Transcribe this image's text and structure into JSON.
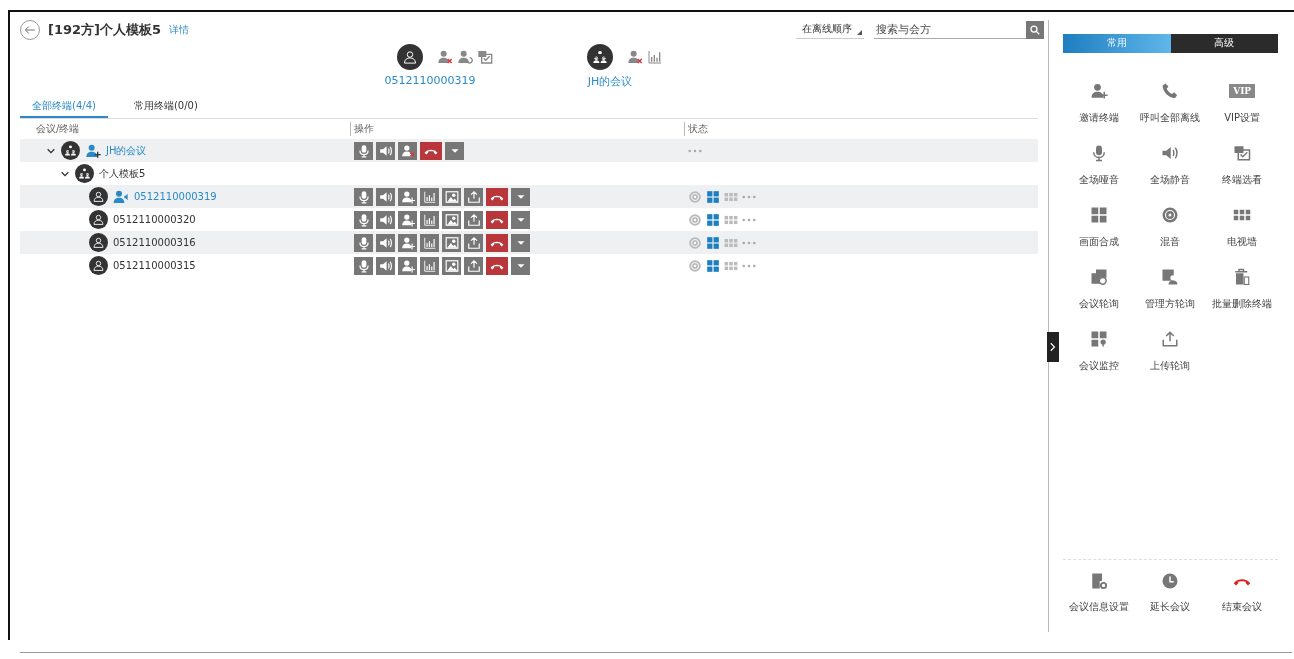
{
  "header": {
    "title": "[192方]个人模板5",
    "details_link": "详情"
  },
  "sort": {
    "value": "在离线顺序"
  },
  "search": {
    "placeholder": "搜索与会方"
  },
  "speakers": [
    {
      "name": "0512110000319",
      "kind": "terminal"
    },
    {
      "name": "JH的会议",
      "kind": "conference"
    }
  ],
  "tabs": [
    {
      "label": "全部终端(4/4)",
      "selected": true
    },
    {
      "label": "常用终端(0/0)",
      "selected": false
    }
  ],
  "table": {
    "columns": [
      "会议/终端",
      "操作",
      "状态"
    ],
    "rows": [
      {
        "name": "JH的会议",
        "kind": "conference",
        "active": true,
        "expanded": true,
        "children": [
          {
            "name": "个人模板5",
            "kind": "group",
            "expanded": true,
            "children": [
              {
                "name": "0512110000319",
                "kind": "terminal",
                "active": true
              },
              {
                "name": "0512110000320",
                "kind": "terminal",
                "active": false
              },
              {
                "name": "0512110000316",
                "kind": "terminal",
                "active": false
              },
              {
                "name": "0512110000315",
                "kind": "terminal",
                "active": false
              }
            ]
          }
        ]
      }
    ]
  },
  "panel": {
    "vip_icon_text": "VIP",
    "tabs": [
      {
        "label": "常用",
        "selected": true
      },
      {
        "label": "高级",
        "selected": false
      }
    ],
    "actions": [
      {
        "label": "邀请终端",
        "kind": "invite"
      },
      {
        "label": "呼叫全部离线",
        "kind": "call"
      },
      {
        "label": "VIP设置",
        "kind": "vip"
      },
      {
        "label": "全场哑音",
        "kind": "mute"
      },
      {
        "label": "全场静音",
        "kind": "silence"
      },
      {
        "label": "终端选看",
        "kind": "view"
      },
      {
        "label": "画面合成",
        "kind": "layout"
      },
      {
        "label": "混音",
        "kind": "mix"
      },
      {
        "label": "电视墙",
        "kind": "tvwall"
      },
      {
        "label": "会议轮询",
        "kind": "poll"
      },
      {
        "label": "管理方轮询",
        "kind": "adminpoll"
      },
      {
        "label": "批量删除终端",
        "kind": "delete"
      },
      {
        "label": "会议监控",
        "kind": "monitor"
      },
      {
        "label": "上传轮询",
        "kind": "upload"
      }
    ],
    "footer": [
      {
        "label": "会议信息设置",
        "kind": "settings"
      },
      {
        "label": "延长会议",
        "kind": "extend"
      },
      {
        "label": "结束会议",
        "kind": "end"
      }
    ]
  }
}
